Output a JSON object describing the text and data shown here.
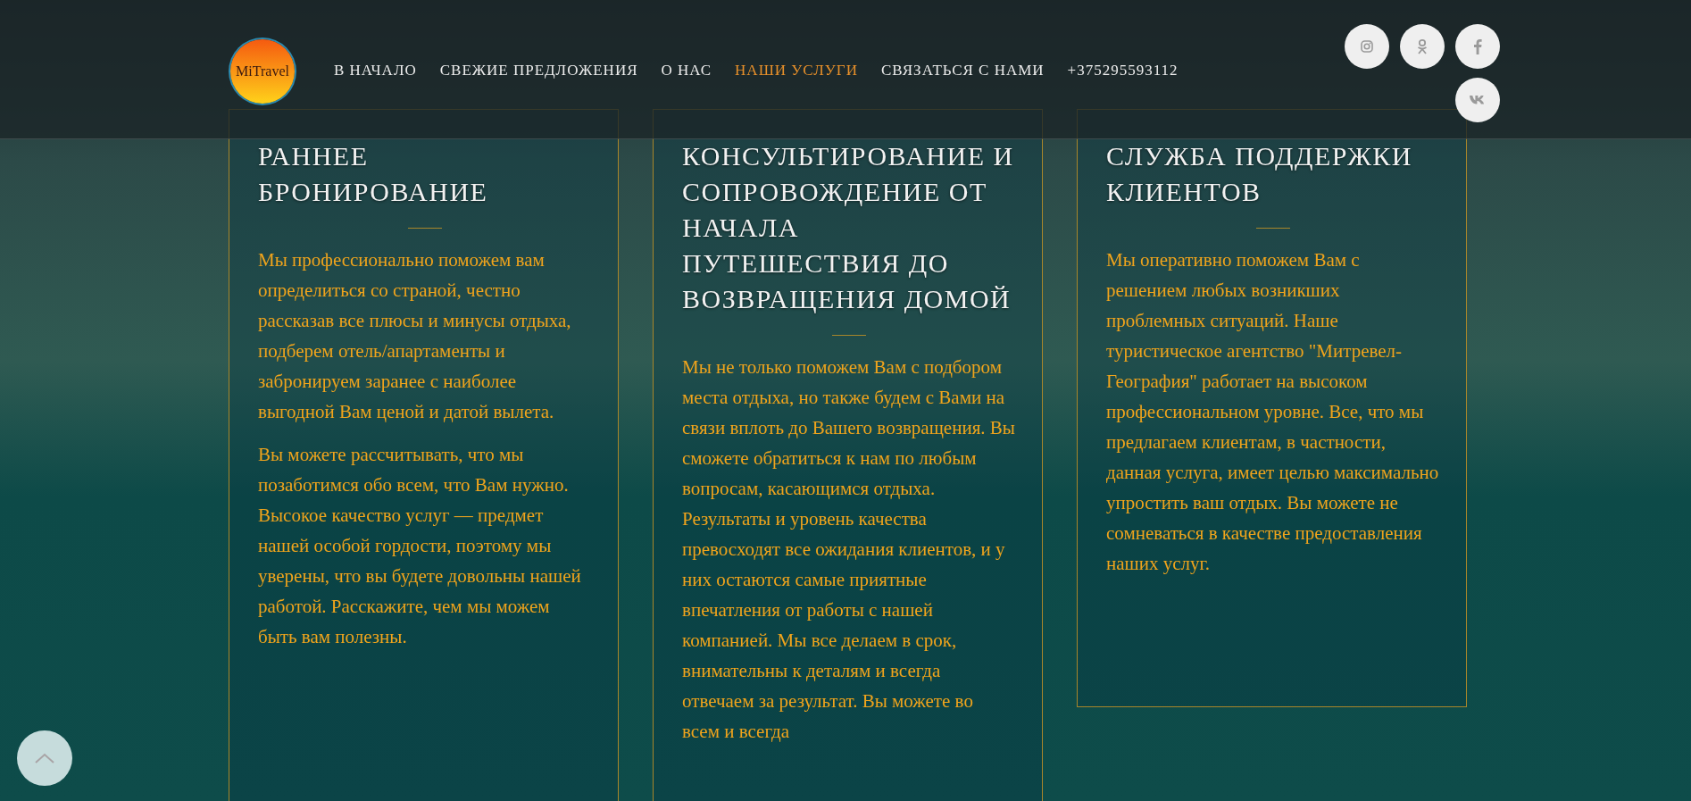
{
  "header": {
    "logo_text": "MiTravel",
    "nav": [
      {
        "label": "В НАЧАЛО",
        "selected": false
      },
      {
        "label": "СВЕЖИЕ ПРЕДЛОЖЕНИЯ",
        "selected": false
      },
      {
        "label": "О НАС",
        "selected": false
      },
      {
        "label": "НАШИ УСЛУГИ",
        "selected": true
      },
      {
        "label": "СВЯЗАТЬСЯ С НАМИ",
        "selected": false
      },
      {
        "label": "+375295593112",
        "selected": false
      }
    ],
    "social": [
      {
        "kind": "instagram"
      },
      {
        "kind": "odnoklassniki"
      },
      {
        "kind": "facebook"
      },
      {
        "kind": "vk"
      }
    ]
  },
  "services": [
    {
      "title": "РАННЕЕ БРОНИРОВАНИЕ",
      "paragraphs": [
        "Мы профессионально поможем вам определиться со страной, честно рассказав все плюсы и минусы отдыха, подберем отель/апартаменты и забронируем заранее с наиболее выгодной Вам ценой и датой вылета.",
        "Вы можете рассчитывать, что мы позаботимся обо всем, что Вам нужно. Высокое качество услуг — предмет нашей особой гордости, поэтому мы уверены, что вы будете довольны нашей работой. Расскажите, чем мы можем быть вам полезны."
      ]
    },
    {
      "title": "КОНСУЛЬТИРОВАНИЕ И СОПРОВОЖДЕНИЕ ОТ НАЧАЛА ПУТЕШЕСТВИЯ ДО ВОЗВРАЩЕНИЯ ДОМОЙ",
      "paragraphs": [
        "Мы не только поможем Вам с подбором места отдыха, но также будем с Вами на связи вплоть до Вашего возвращения. Вы сможете обратиться к нам по любым вопросам, касающимся отдыха. Результаты и уровень качества превосходят все ожидания клиентов, и у них остаются самые приятные впечатления от работы с нашей компанией. Мы все делаем в срок, внимательны к деталям и всегда отвечаем за результат. Вы можете во всем и всегда"
      ]
    },
    {
      "title": "СЛУЖБА ПОДДЕРЖКИ КЛИЕНТОВ",
      "paragraphs": [
        "Мы оперативно поможем Вам с решением любых возникших проблемных ситуаций. Наше туристическое агентство \"Митревел-География\" работает на высоком профессиональном уровне. Все, что мы предлагаем клиентам, в частности, данная услуга, имеет целью максимально упростить ваш отдых. Вы можете не сомневаться в качестве предоставления наших услуг."
      ]
    }
  ]
}
